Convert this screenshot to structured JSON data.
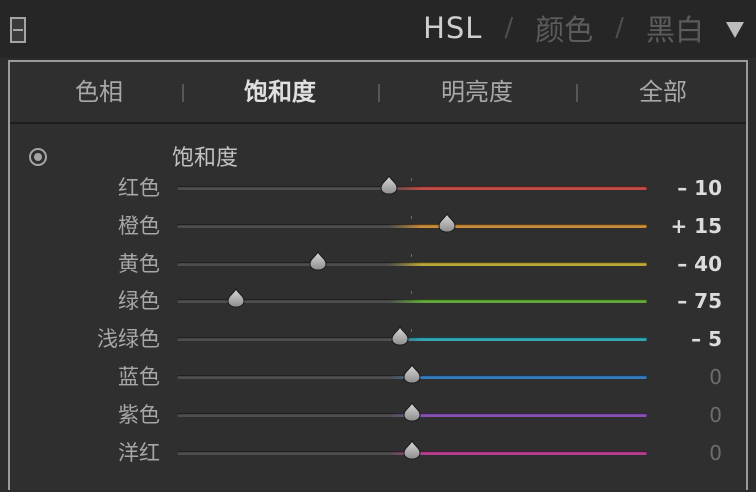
{
  "header": {
    "tabs": [
      {
        "label": "HSL",
        "active": true
      },
      {
        "label": "颜色",
        "active": false
      },
      {
        "label": "黑白",
        "active": false
      }
    ],
    "separator": "/"
  },
  "subtabs": [
    {
      "label": "色相",
      "active": false
    },
    {
      "label": "饱和度",
      "active": true
    },
    {
      "label": "明亮度",
      "active": false
    },
    {
      "label": "全部",
      "active": false
    }
  ],
  "section": {
    "title": "饱和度"
  },
  "sliders": [
    {
      "label": "红色",
      "value": -10,
      "display": "– 10",
      "color": "#c24c48"
    },
    {
      "label": "橙色",
      "value": 15,
      "display": "+ 15",
      "color": "#c98c3c"
    },
    {
      "label": "黄色",
      "value": -40,
      "display": "– 40",
      "color": "#bba638"
    },
    {
      "label": "绿色",
      "value": -75,
      "display": "– 75",
      "color": "#62a63c"
    },
    {
      "label": "浅绿色",
      "value": -5,
      "display": "– 5",
      "color": "#34a7b4"
    },
    {
      "label": "蓝色",
      "value": 0,
      "display": "0",
      "color": "#357bbd"
    },
    {
      "label": "紫色",
      "value": 0,
      "display": "0",
      "color": "#8652b4"
    },
    {
      "label": "洋红",
      "value": 0,
      "display": "0",
      "color": "#b43f8c"
    }
  ],
  "colors": {
    "panel_bg": "#2c2c2c",
    "header_bg": "#262626",
    "frame_border": "#9a9a9a",
    "track_neutral": "#4e4e4e"
  }
}
